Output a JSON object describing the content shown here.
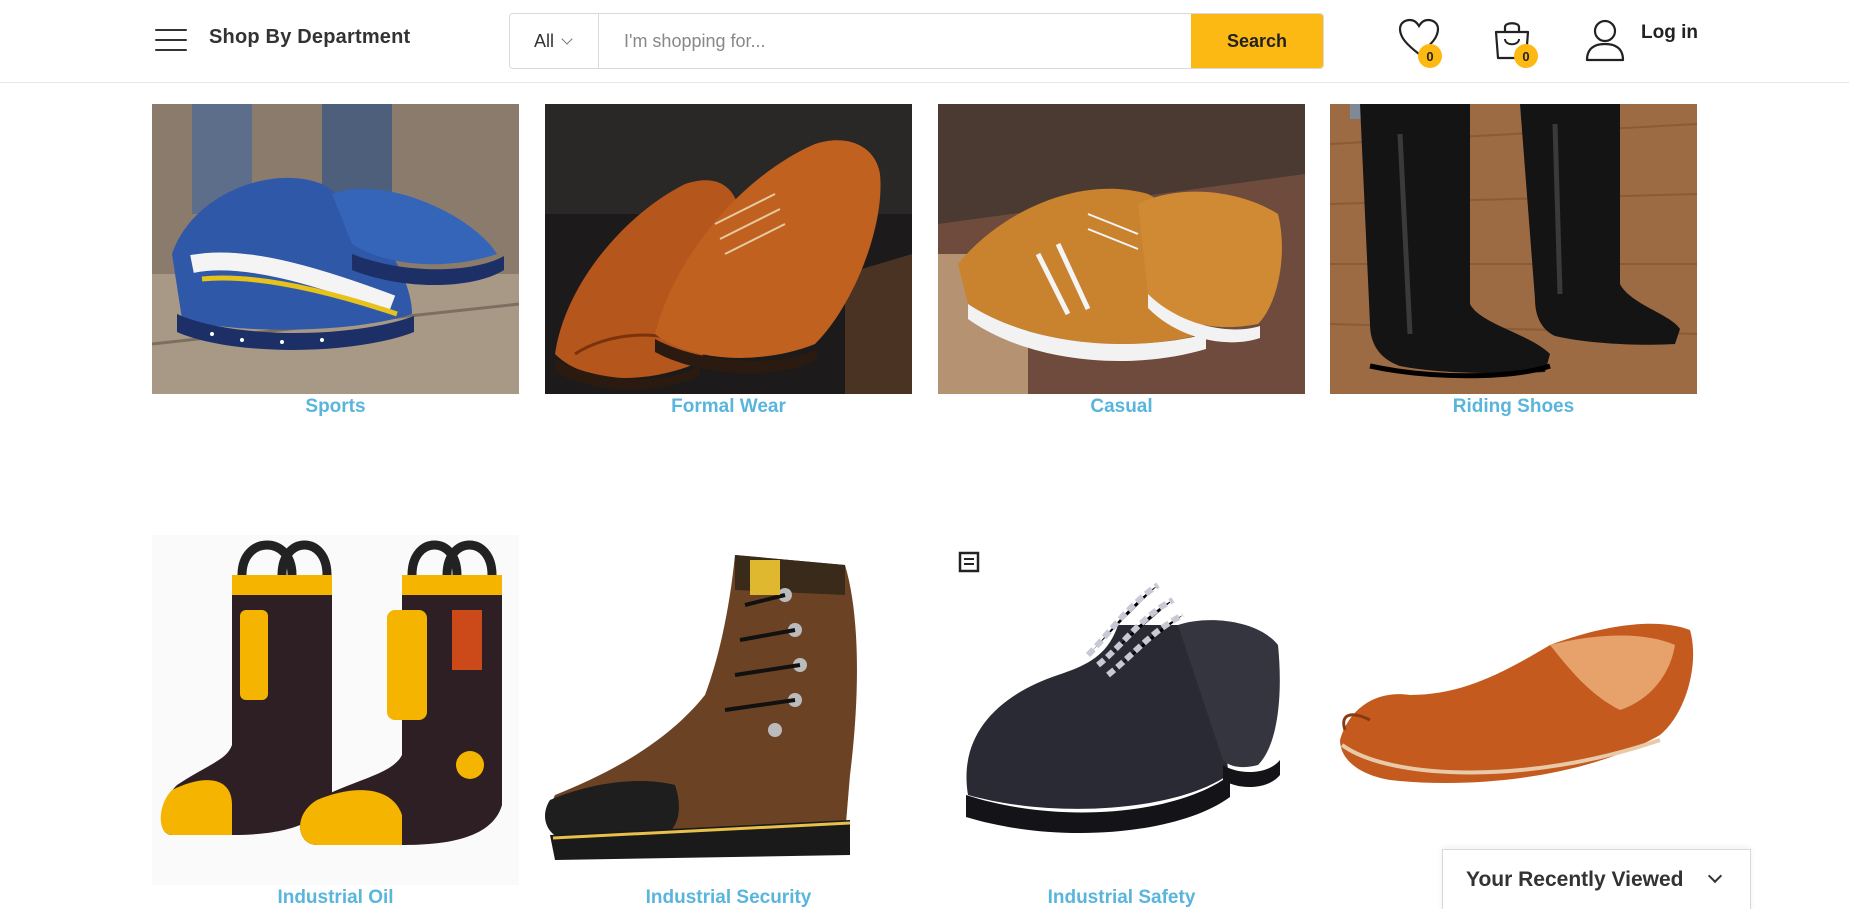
{
  "header": {
    "department_label": "Shop By Department",
    "search": {
      "category": "All",
      "placeholder": "I'm shopping for...",
      "value": "",
      "button_label": "Search"
    },
    "wishlist_count": "0",
    "cart_count": "0",
    "login_label": "Log in"
  },
  "categories_row1": [
    {
      "label": "Sports",
      "image": "blue-sneakers"
    },
    {
      "label": "Formal Wear",
      "image": "brown-brogues"
    },
    {
      "label": "Casual",
      "image": "tan-casual-shoes"
    },
    {
      "label": "Riding Shoes",
      "image": "black-riding-boots"
    }
  ],
  "categories_row2": [
    {
      "label": "Industrial Oil",
      "image": "yellow-rubber-boots"
    },
    {
      "label": "Industrial Security",
      "image": "brown-work-boot"
    },
    {
      "label": "Industrial Safety",
      "image": "black-safety-shoes"
    },
    {
      "label": "",
      "image": "khussa-slipper"
    }
  ],
  "recently_viewed": {
    "label": "Your Recently Viewed"
  },
  "colors": {
    "accent": "#fdb913",
    "category_link": "#59b5dc",
    "text": "#333333"
  }
}
